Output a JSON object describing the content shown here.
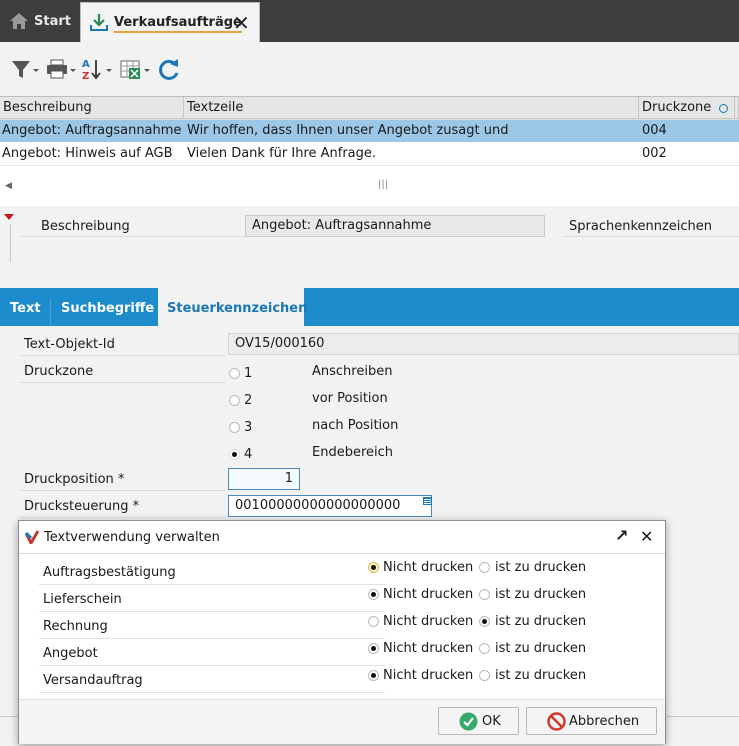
{
  "tabs": {
    "start_label": "Start",
    "active_label": "Verkaufsaufträge"
  },
  "toolbar": {
    "icons": [
      "filter-icon",
      "print-icon",
      "sort-az-icon",
      "excel-export-icon",
      "refresh-icon"
    ]
  },
  "grid": {
    "columns": [
      "Beschreibung",
      "Textzeile",
      "Druckzone"
    ],
    "rows": [
      {
        "beschreibung": "Angebot: Auftragsannahme",
        "textzeile": "Wir hoffen, dass Ihnen unser Angebot zusagt und",
        "druckzone": "004",
        "selected": true
      },
      {
        "beschreibung": "Angebot: Hinweis auf AGB",
        "textzeile": "Vielen Dank für Ihre Anfrage.",
        "druckzone": "002",
        "selected": false
      }
    ]
  },
  "detail": {
    "beschreibung_label": "Beschreibung",
    "beschreibung_value": "Angebot: Auftragsannahme",
    "sprache_label": "Sprachenkennzeichen"
  },
  "subtabs": [
    "Text",
    "Suchbegriffe",
    "Steuerkennzeichen"
  ],
  "form": {
    "textobjekt_label": "Text-Objekt-Id",
    "textobjekt_value": "OV15/000160",
    "druckzone_label": "Druckzone",
    "druckzone_options": [
      {
        "value": "1",
        "label": "Anschreiben",
        "checked": false
      },
      {
        "value": "2",
        "label": "vor Position",
        "checked": false
      },
      {
        "value": "3",
        "label": "nach Position",
        "checked": false
      },
      {
        "value": "4",
        "label": "Endebereich",
        "checked": true
      }
    ],
    "druckposition_label": "Druckposition *",
    "druckposition_value": "1",
    "drucksteuerung_label": "Drucksteuerung *",
    "drucksteuerung_value": "00100000000000000000"
  },
  "dialog": {
    "title": "Textverwendung verwalten",
    "opt_no": "Nicht drucken",
    "opt_yes": "ist zu drucken",
    "rows": [
      {
        "label": "Auftragsbestätigung",
        "choice": "no"
      },
      {
        "label": "Lieferschein",
        "choice": "no"
      },
      {
        "label": "Rechnung",
        "choice": "yes"
      },
      {
        "label": "Angebot",
        "choice": "no"
      },
      {
        "label": "Versandauftrag",
        "choice": "no"
      }
    ],
    "ok_label": "OK",
    "cancel_label": "Abbrechen"
  },
  "colors": {
    "accent_blue": "#1c8ccc",
    "selection": "#9cc7e6",
    "tab_underline": "#e8a13a"
  }
}
